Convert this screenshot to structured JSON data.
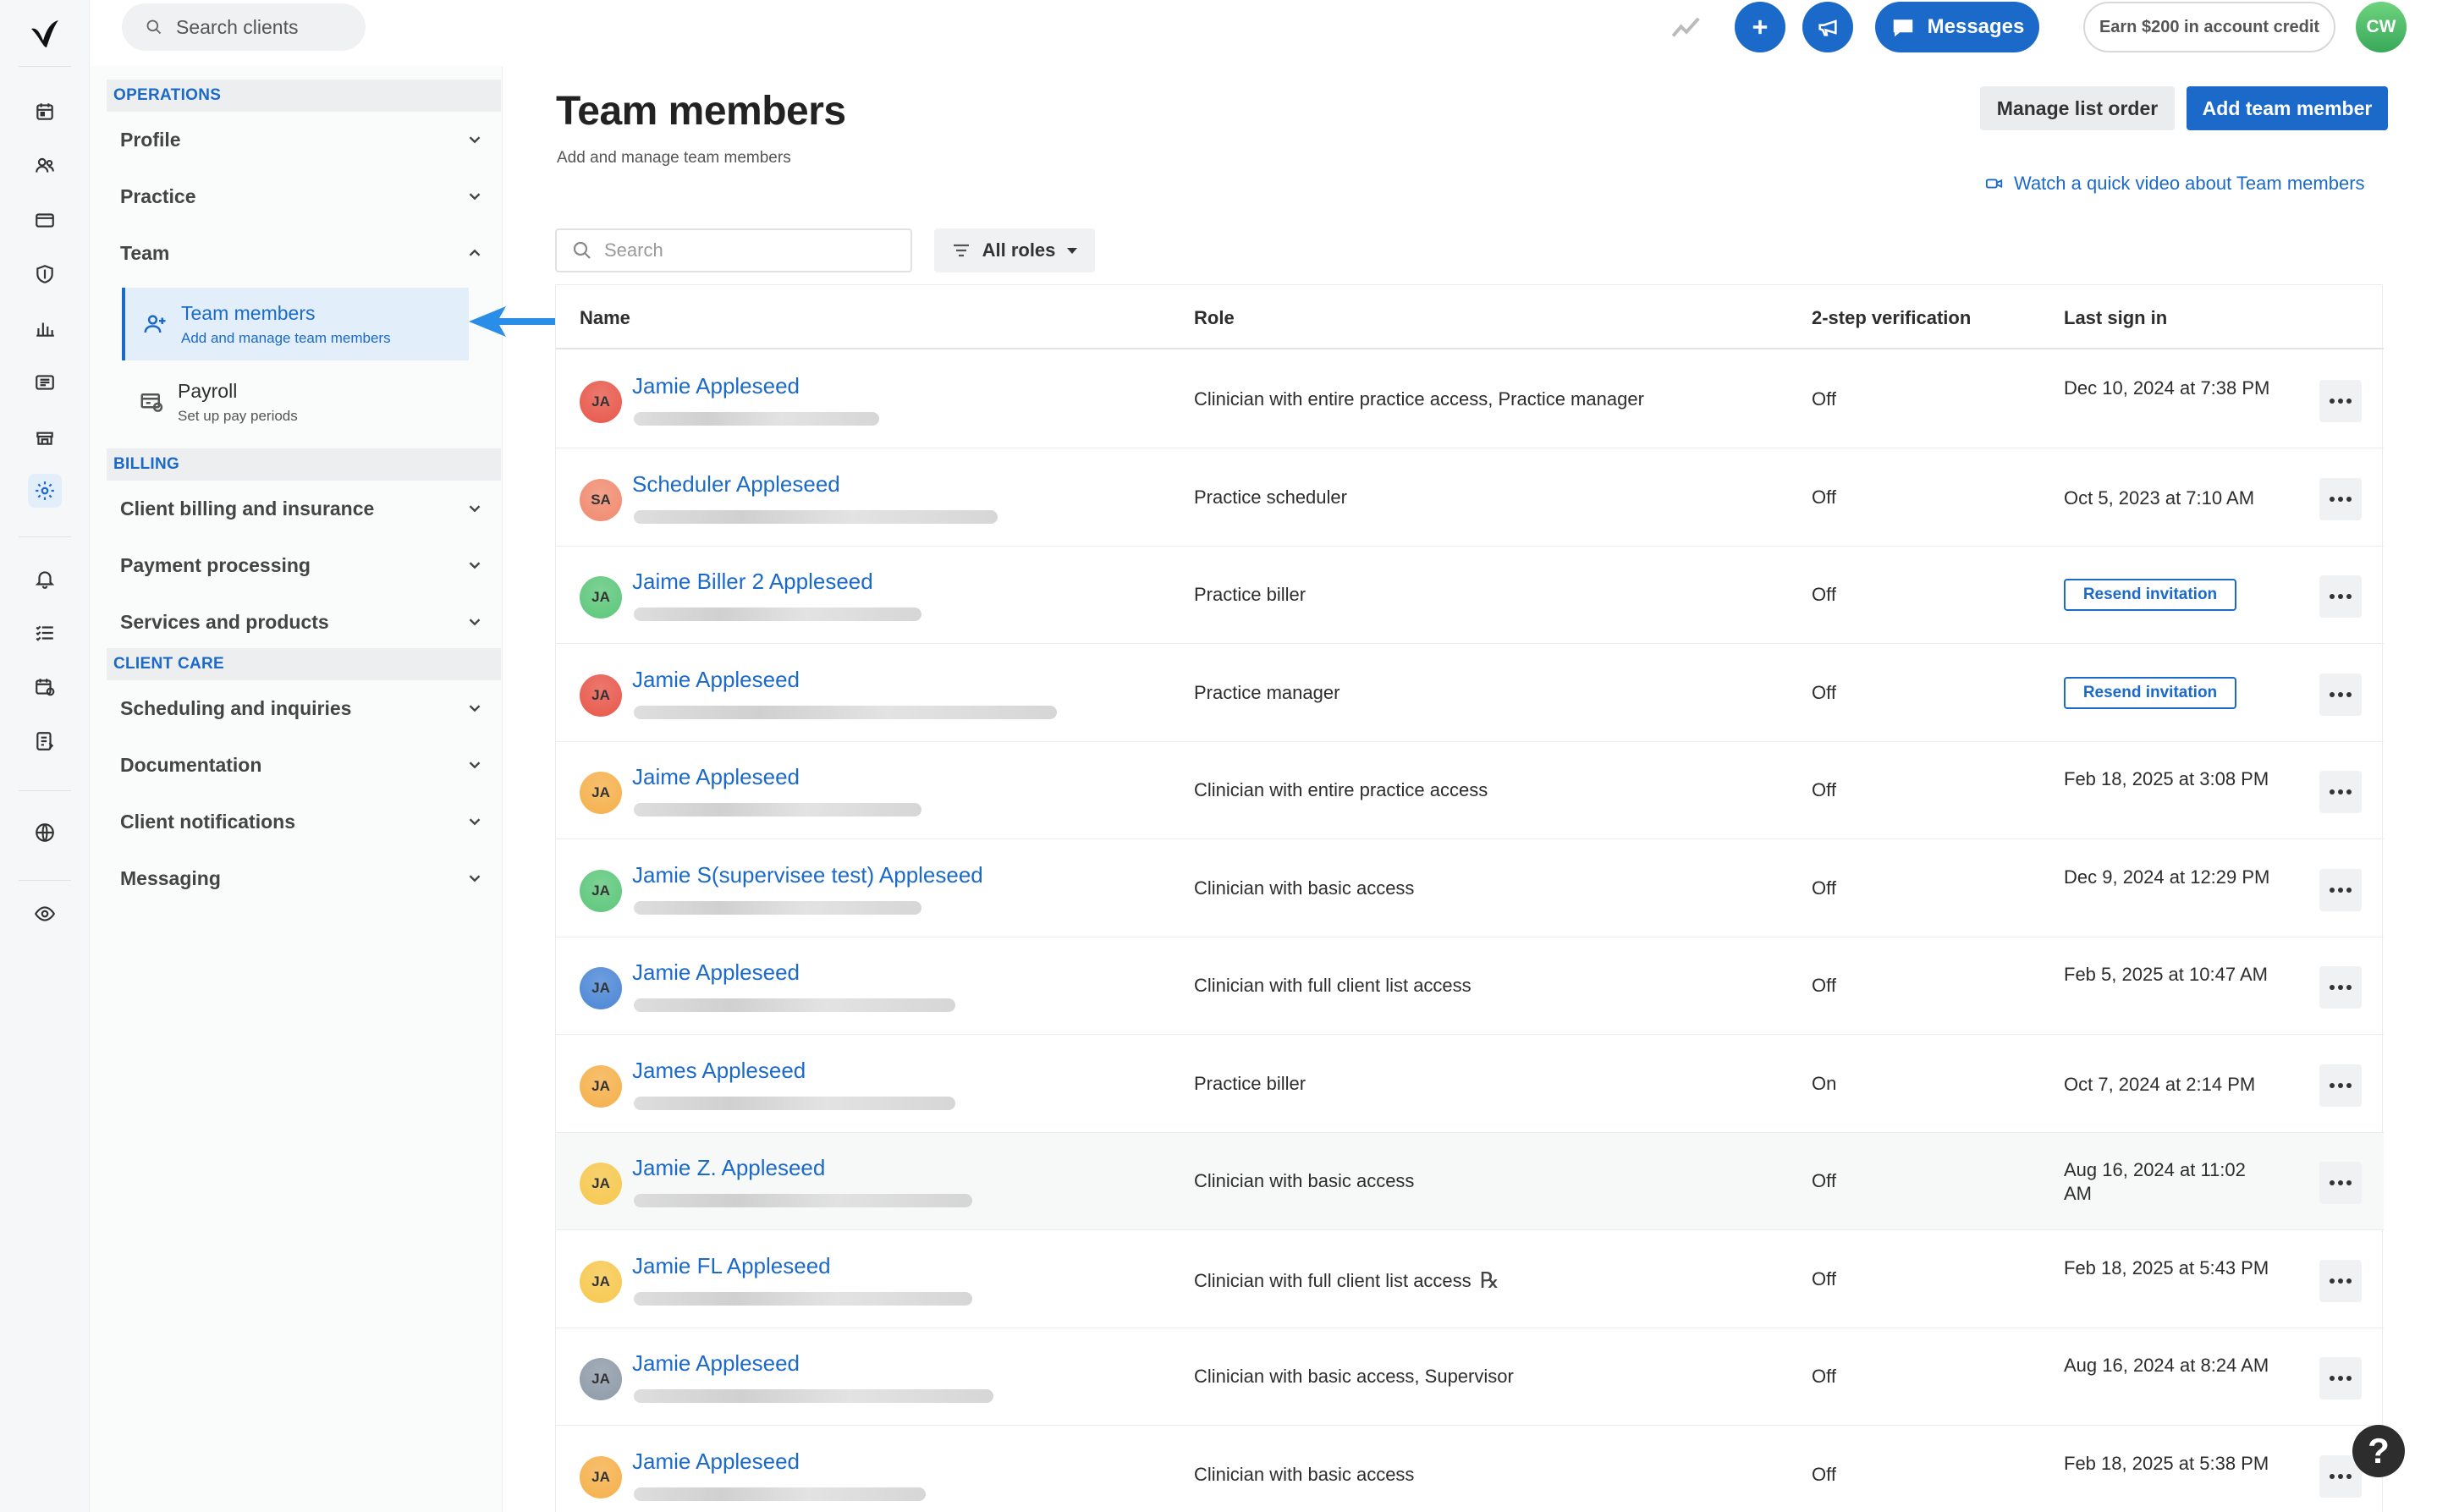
{
  "topbar": {
    "search_placeholder": "Search clients",
    "messages_label": "Messages",
    "credit_label": "Earn $200 in account credit",
    "user_initials": "CW"
  },
  "settings_nav": {
    "operations_header": "OPERATIONS",
    "profile": "Profile",
    "practice": "Practice",
    "team": "Team",
    "team_members_title": "Team members",
    "team_members_desc": "Add and manage team members",
    "payroll_title": "Payroll",
    "payroll_desc": "Set up pay periods",
    "billing_header": "BILLING",
    "client_billing": "Client billing and insurance",
    "payment_processing": "Payment processing",
    "services_products": "Services and products",
    "client_care_header": "CLIENT CARE",
    "scheduling": "Scheduling and inquiries",
    "documentation": "Documentation",
    "client_notifications": "Client notifications",
    "messaging": "Messaging"
  },
  "main": {
    "title": "Team members",
    "subtitle": "Add and manage team members",
    "manage_order_label": "Manage list order",
    "add_member_label": "Add team member",
    "video_link": "Watch a quick video about Team members",
    "search_placeholder": "Search",
    "roles_filter": "All roles"
  },
  "table": {
    "headers": {
      "name": "Name",
      "role": "Role",
      "two_step": "2-step verification",
      "last_sign_in": "Last sign in"
    },
    "resend_label": "Resend invitation",
    "rows": [
      {
        "initials": "JA",
        "name": "Jamie Appleseed",
        "role": "Clinician with entire practice access, Practice manager",
        "two_step": "Off",
        "last_sign_in": "Dec 10, 2024 at 7:38 PM",
        "avatar_color": "#e8574a"
      },
      {
        "initials": "SA",
        "name": "Scheduler Appleseed",
        "role": "Practice scheduler",
        "two_step": "Off",
        "last_sign_in": "Oct 5, 2023 at 7:10 AM",
        "avatar_color": "#f08a6e"
      },
      {
        "initials": "JA",
        "name": "Jaime Biller 2 Appleseed",
        "role": "Practice biller",
        "two_step": "Off",
        "last_sign_in": "",
        "avatar_color": "#5cc77a"
      },
      {
        "initials": "JA",
        "name": "Jamie Appleseed",
        "role": "Practice manager",
        "two_step": "Off",
        "last_sign_in": "",
        "avatar_color": "#e8574a"
      },
      {
        "initials": "JA",
        "name": "Jaime Appleseed",
        "role": "Clinician with entire practice access",
        "two_step": "Off",
        "last_sign_in": "Feb 18, 2025 at 3:08 PM",
        "avatar_color": "#f5b04a"
      },
      {
        "initials": "JA",
        "name": "Jamie S(supervisee test) Appleseed",
        "role": "Clinician with basic access",
        "two_step": "Off",
        "last_sign_in": "Dec 9, 2024 at 12:29 PM",
        "avatar_color": "#5cc77a"
      },
      {
        "initials": "JA",
        "name": "Jamie Appleseed",
        "role": "Clinician with full client list access",
        "two_step": "Off",
        "last_sign_in": "Feb 5, 2025 at 10:47 AM",
        "avatar_color": "#4b86d6"
      },
      {
        "initials": "JA",
        "name": "James Appleseed",
        "role": "Practice biller",
        "two_step": "On",
        "last_sign_in": "Oct 7, 2024 at 2:14 PM",
        "avatar_color": "#f5b04a"
      },
      {
        "initials": "JA",
        "name": "Jamie Z. Appleseed",
        "role": "Clinician with basic access",
        "two_step": "Off",
        "last_sign_in": "Aug 16, 2024 at 11:02 AM",
        "avatar_color": "#f7c84e"
      },
      {
        "initials": "JA",
        "name": "Jamie FL Appleseed",
        "role": "Clinician with full client list access",
        "two_step": "Off",
        "last_sign_in": "Feb 18, 2025 at 5:43 PM",
        "avatar_color": "#f7c84e"
      },
      {
        "initials": "JA",
        "name": "Jamie Appleseed",
        "role": "Clinician with basic access, Supervisor",
        "two_step": "Off",
        "last_sign_in": "Aug 16, 2024 at 8:24 AM",
        "avatar_color": "#8e9aa8"
      },
      {
        "initials": "JA",
        "name": "Jamie Appleseed",
        "role": "Clinician with basic access",
        "two_step": "Off",
        "last_sign_in": "Feb 18, 2025 at 5:38 PM",
        "avatar_color": "#f5b04a"
      }
    ]
  },
  "help_label": "?"
}
